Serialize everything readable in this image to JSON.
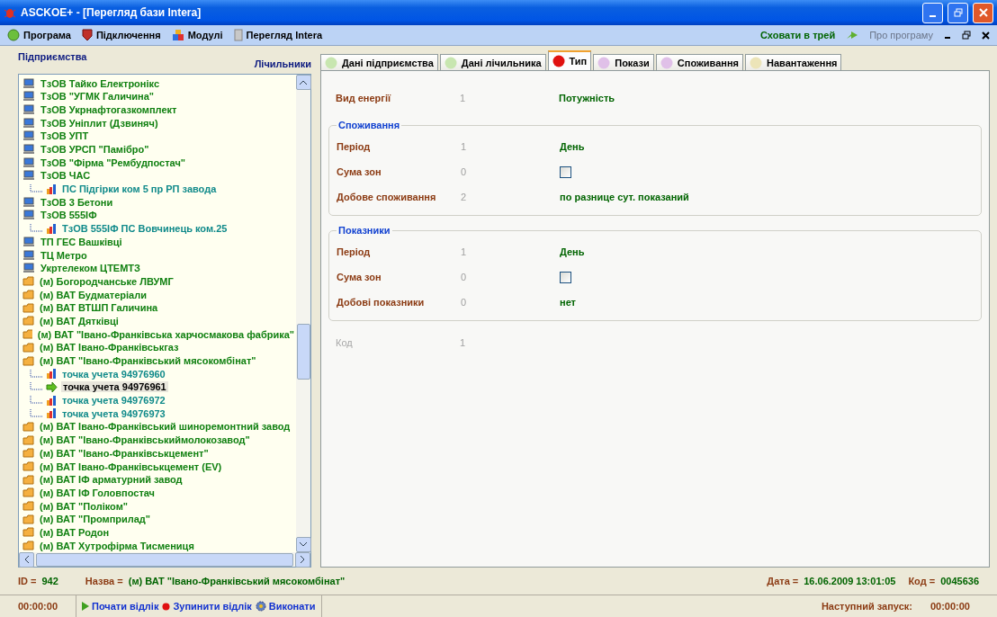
{
  "window": {
    "title": "ASCKOE+ - [Перегляд бази Intera]"
  },
  "menu": {
    "items": [
      {
        "label": "Програма",
        "kind": "globe"
      },
      {
        "label": "Підключення",
        "kind": "shield"
      },
      {
        "label": "Модулі",
        "kind": "blocks"
      },
      {
        "label": "Перегляд Intera",
        "kind": "doc"
      }
    ],
    "right": [
      {
        "label": "Сховати в трей",
        "disabled": false
      },
      {
        "label": "Про програму",
        "disabled": true
      }
    ]
  },
  "left_panel": {
    "title": "Підприємства",
    "link": "Лічильники"
  },
  "tree": {
    "items": [
      {
        "label": "ТзОВ Тайко Електронікс",
        "kind": "computer",
        "selected": false
      },
      {
        "label": "ТзОВ \"УГМК Галичина\"",
        "kind": "computer",
        "selected": false
      },
      {
        "label": "ТзОВ Укрнафтогазкомплект",
        "kind": "computer",
        "selected": false
      },
      {
        "label": "ТзОВ Уніплит (Дзвиняч)",
        "kind": "computer",
        "selected": false
      },
      {
        "label": "ТзОВ УПТ",
        "kind": "computer",
        "selected": false
      },
      {
        "label": "ТзОВ УРСП \"Памібро\"",
        "kind": "computer",
        "selected": false
      },
      {
        "label": "ТзОВ \"Фірма \"Рембудпостач\"",
        "kind": "computer",
        "selected": false
      },
      {
        "label": "ТзОВ ЧАС",
        "kind": "computer",
        "selected": false,
        "children": [
          {
            "label": "ПС Підгірки ком 5 пр РП завода",
            "kind": "meter",
            "selected": false
          }
        ]
      },
      {
        "label": "ТзОВ 3 Бетони",
        "kind": "computer",
        "selected": false
      },
      {
        "label": "ТзОВ 555ІФ",
        "kind": "computer",
        "selected": false,
        "children": [
          {
            "label": "ТзОВ 555ІФ ПС Вовчинець ком.25",
            "kind": "meter",
            "selected": false
          }
        ]
      },
      {
        "label": "ТП ГЕС Вашківці",
        "kind": "computer",
        "selected": false
      },
      {
        "label": "ТЦ Метро",
        "kind": "computer",
        "selected": false
      },
      {
        "label": "Укртелеком ЦТЕМТЗ",
        "kind": "computer",
        "selected": false
      },
      {
        "label": "(м) Богородчанське ЛВУМГ",
        "kind": "folder",
        "selected": false
      },
      {
        "label": "(м) ВАТ Будматеріали",
        "kind": "folder",
        "selected": false
      },
      {
        "label": "(м) ВАТ ВТШП Галичина",
        "kind": "folder",
        "selected": false
      },
      {
        "label": "(м) ВАТ Дятківці",
        "kind": "folder",
        "selected": false
      },
      {
        "label": "(м) ВАТ \"Івано-Франківська харчосмакова фабрика\"",
        "kind": "folder",
        "selected": false
      },
      {
        "label": "(м) ВАТ Івано-Франківськгаз",
        "kind": "folder",
        "selected": false
      },
      {
        "label": "(м) ВАТ \"Івано-Франківський мясокомбінат\"",
        "kind": "folder",
        "selected": false,
        "children": [
          {
            "label": "точка учета 94976960",
            "kind": "meter",
            "selected": false
          },
          {
            "label": "точка учета 94976961",
            "kind": "arrow",
            "selected": true
          },
          {
            "label": "точка учета 94976972",
            "kind": "meter",
            "selected": false
          },
          {
            "label": "точка учета 94976973",
            "kind": "meter",
            "selected": false
          }
        ]
      },
      {
        "label": "(м) ВАТ Івано-Франківський шиноремонтний завод",
        "kind": "folder",
        "selected": false
      },
      {
        "label": "(м) ВАТ \"Івано-Франківськиймолокозавод\"",
        "kind": "folder",
        "selected": false
      },
      {
        "label": "(м) ВАТ \"Івано-Франківськцемент\"",
        "kind": "folder",
        "selected": false
      },
      {
        "label": "(м) ВАТ Івано-Франківськцемент (EV)",
        "kind": "folder",
        "selected": false
      },
      {
        "label": "(м) ВАТ ІФ арматурний завод",
        "kind": "folder",
        "selected": false
      },
      {
        "label": "(м) ВАТ ІФ Головпостач",
        "kind": "folder",
        "selected": false
      },
      {
        "label": "(м) ВАТ \"Поліком\"",
        "kind": "folder",
        "selected": false
      },
      {
        "label": "(м) ВАТ \"Промприлад\"",
        "kind": "folder",
        "selected": false
      },
      {
        "label": "(м) ВАТ Родон",
        "kind": "folder",
        "selected": false
      },
      {
        "label": "(м) ВАТ Хутрофірма Тисмениця",
        "kind": "folder",
        "selected": false
      }
    ]
  },
  "tabs": [
    {
      "label": "Дані підприємства",
      "selected": false,
      "color": "#c8e6b0"
    },
    {
      "label": "Дані лічильника",
      "selected": false,
      "color": "#c8e6b0"
    },
    {
      "label": "Тип",
      "selected": true,
      "color": "#e01010"
    },
    {
      "label": "Покази",
      "selected": false,
      "color": "#e0c0e8"
    },
    {
      "label": "Споживання",
      "selected": false,
      "color": "#e0c0e8"
    },
    {
      "label": "Навантаження",
      "selected": false,
      "color": "#ece4b8"
    }
  ],
  "form": {
    "energy": {
      "label": "Вид енергії",
      "code": "1",
      "value": "Потужність"
    },
    "groups": [
      {
        "title": "Споживання",
        "rows": [
          {
            "kind": "text",
            "label": "Період",
            "code": "1",
            "value": "День"
          },
          {
            "kind": "checkbox",
            "label": "Сума зон",
            "code": "0",
            "checked": false
          },
          {
            "kind": "text",
            "label": "Добове споживання",
            "code": "2",
            "value": "по разнице сут. показаний"
          }
        ]
      },
      {
        "title": "Показники",
        "rows": [
          {
            "kind": "text",
            "label": "Період",
            "code": "1",
            "value": "День"
          },
          {
            "kind": "checkbox",
            "label": "Сума зон",
            "code": "0",
            "checked": false
          },
          {
            "kind": "text",
            "label": "Добові показники",
            "code": "0",
            "value": "нет"
          }
        ]
      }
    ],
    "code": {
      "label": "Код",
      "code": "1",
      "disabled": true
    }
  },
  "info": {
    "id_label": "ID =",
    "id": "942",
    "name_label": "Назва =",
    "name": "(м) ВАТ \"Івано-Франківський мясокомбінат\"",
    "date_label": "Дата =",
    "date": "16.06.2009 13:01:05",
    "code_label": "Код =",
    "code": "0045636"
  },
  "status_bar": {
    "time": "00:00:00",
    "actions": [
      {
        "label": "Почати відлік",
        "kind": "play"
      },
      {
        "label": "Зупинити відлік",
        "kind": "stop"
      },
      {
        "label": "Виконати",
        "kind": "gear"
      }
    ],
    "next_label": "Наступний запуск:",
    "next_time": "00:00:00"
  }
}
